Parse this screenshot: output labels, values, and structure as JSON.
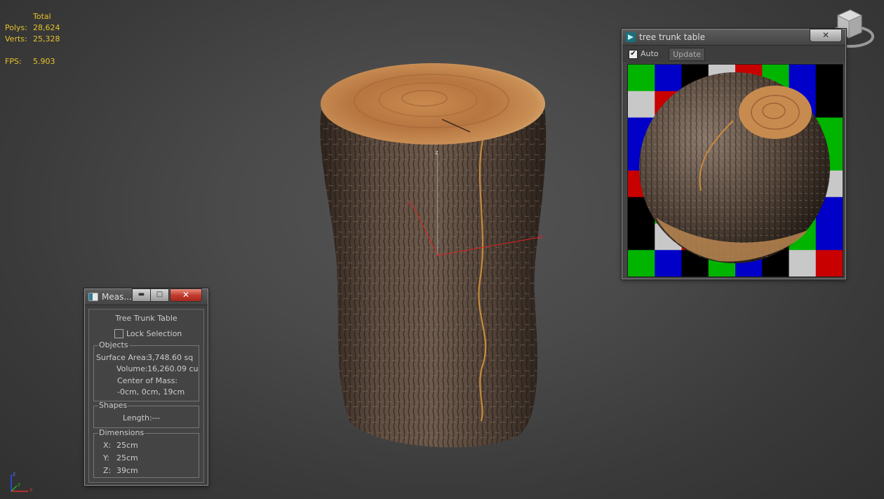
{
  "stats": {
    "total_label": "Total",
    "polys_label": "Polys:",
    "polys_value": "28,624",
    "verts_label": "Verts:",
    "verts_value": "25,328",
    "fps_label": "FPS:",
    "fps_value": "5.903"
  },
  "viewcube": {
    "icon": "viewcube-icon"
  },
  "gizmo": {
    "x_label": "x",
    "y_label": "y",
    "z_label": "z"
  },
  "tripod": {
    "x_label": "x",
    "y_label": "y",
    "z_label": "z"
  },
  "material_window": {
    "title": "tree trunk table",
    "close_label": "✕",
    "auto_label": "Auto",
    "auto_checked": "✔",
    "update_label": "Update",
    "checker_colors": [
      "#00b400",
      "#0000c8",
      "#000000",
      "#c8c8c8",
      "#c80000",
      "#00b400",
      "#0000c8",
      "#000000"
    ]
  },
  "measure_window": {
    "title": "Meas...",
    "minimize_label": "▬",
    "maximize_label": "□",
    "close_label": "✕",
    "object_name": "Tree Trunk Table",
    "lock_label": "Lock Selection",
    "objects": {
      "group_label": "Objects",
      "surface_area_label": "Surface Area:",
      "surface_area_value": "3,748.60 sq",
      "volume_label": "Volume:",
      "volume_value": "16,260.09 cu",
      "center_label": "Center of Mass:",
      "center_value": "-0cm, 0cm, 19cm"
    },
    "shapes": {
      "group_label": "Shapes",
      "length_label": "Length:",
      "length_value": "---"
    },
    "dimensions": {
      "group_label": "Dimensions",
      "x_label": "X:",
      "x_value": "25cm",
      "y_label": "Y:",
      "y_value": "25cm",
      "z_label": "Z:",
      "z_value": "39cm"
    }
  }
}
